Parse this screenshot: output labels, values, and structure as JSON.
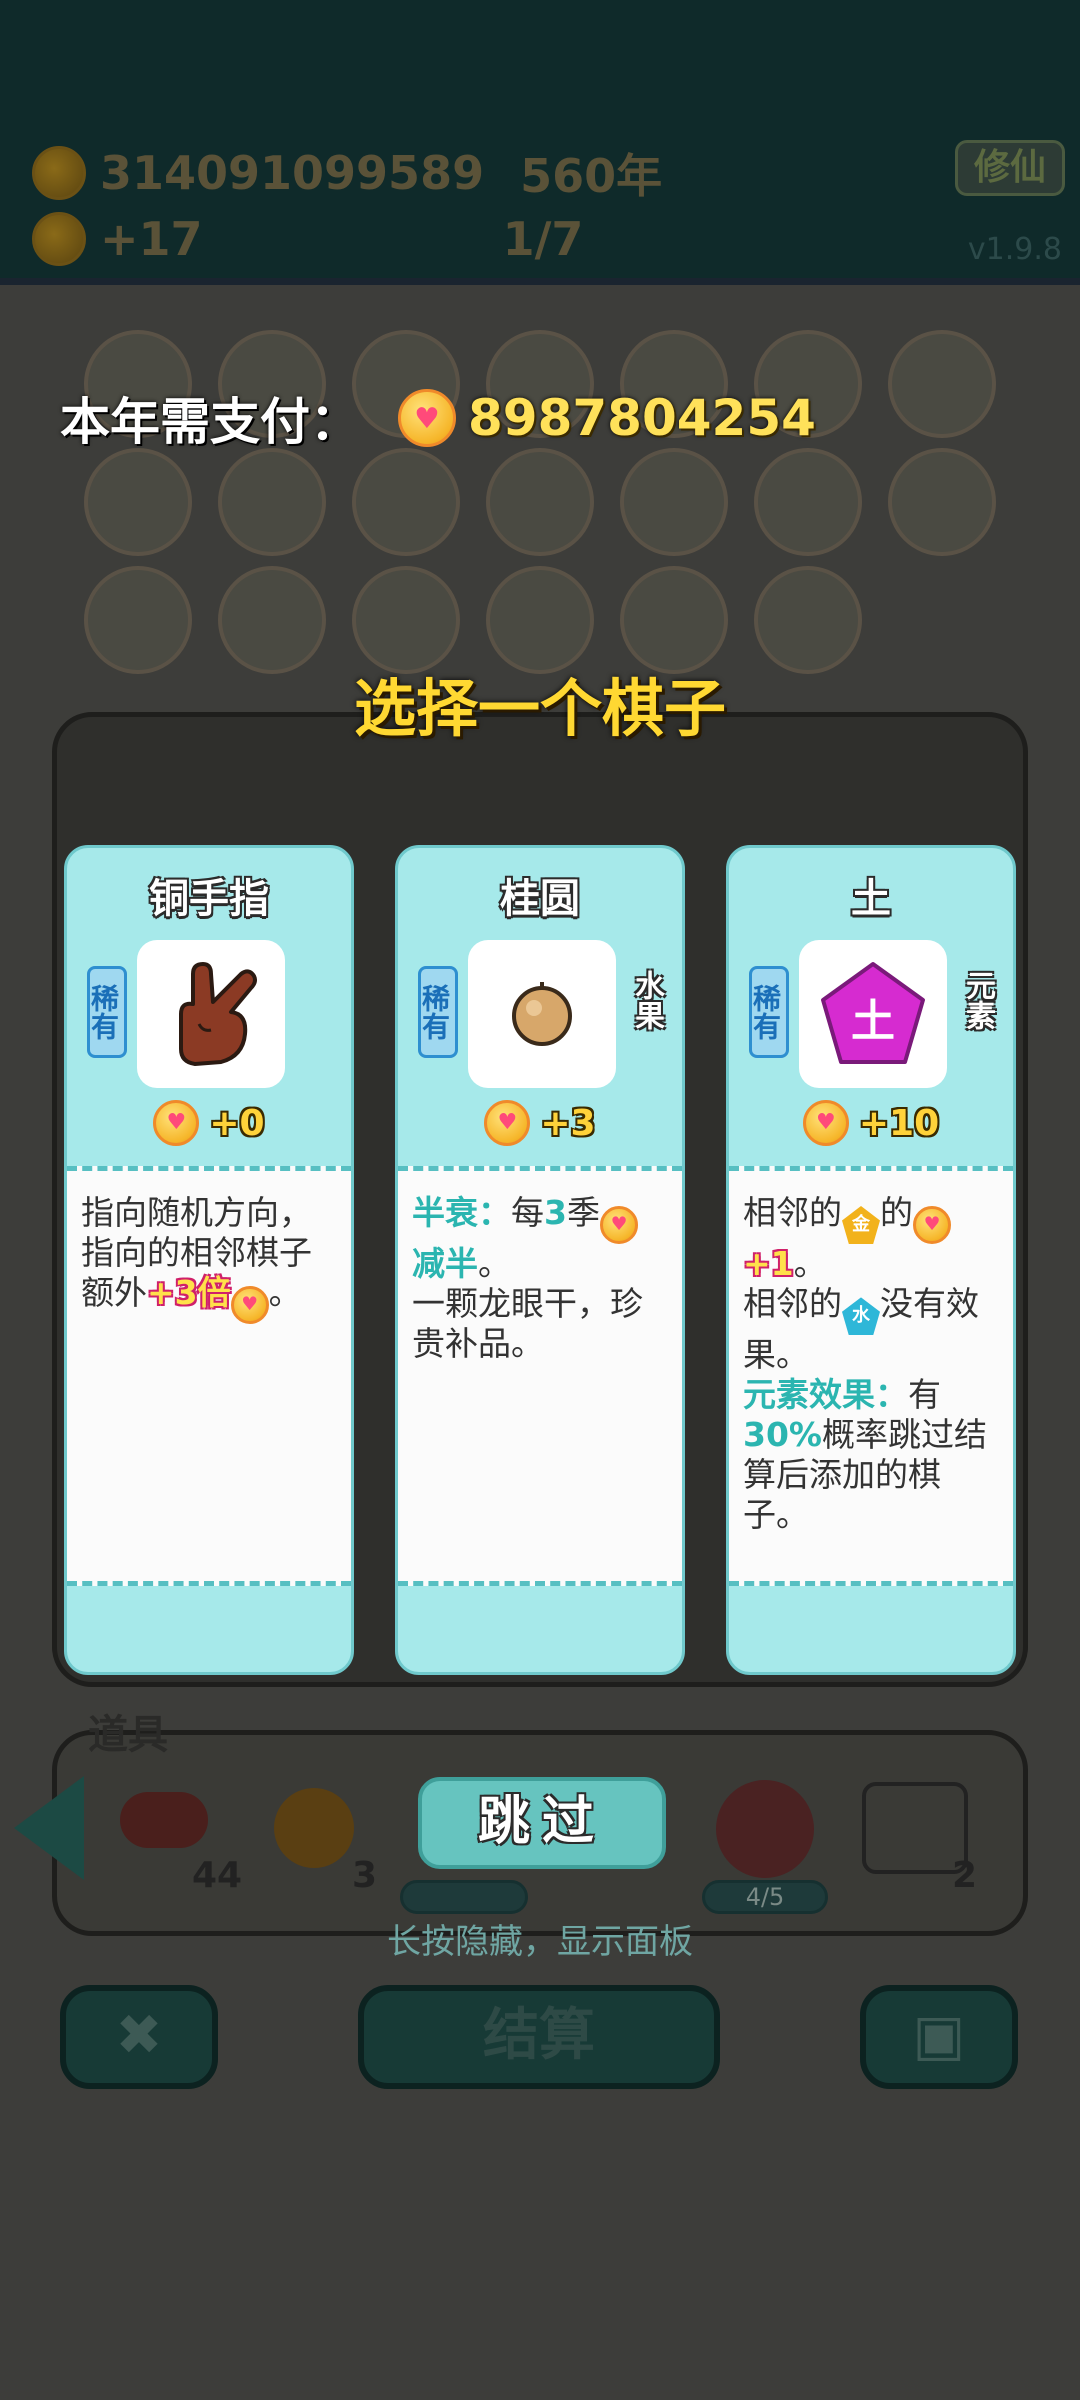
{
  "hud": {
    "coins": "314091099589",
    "year": "560年",
    "income": "+17",
    "progress": "1/7",
    "cultivate_label": "修仙",
    "version": "v1.9.8"
  },
  "payment": {
    "label": "本年需支付：",
    "amount": "8987804254"
  },
  "choose_title": "选择一个棋子",
  "cards": [
    {
      "name": "铜手指",
      "rarity": "稀有",
      "category": "",
      "value": "+0",
      "icon": "pointing-hand-icon",
      "desc": {
        "line1": "指向随机方向，",
        "line2": "指向的相邻棋子",
        "line3_prefix": "额外",
        "bonus": "+3倍",
        "suffix": "。"
      }
    },
    {
      "name": "桂圆",
      "rarity": "稀有",
      "category": "水果",
      "value": "+3",
      "icon": "longan-icon",
      "desc": {
        "key1": "半衰：",
        "pre": "每",
        "num": "3",
        "post": "季",
        "key2": "减半",
        "dot": "。",
        "flavor": "一颗龙眼干，珍贵补品。"
      }
    },
    {
      "name": "土",
      "rarity": "稀有",
      "category": "元素",
      "value": "+10",
      "icon": "earth-element-icon",
      "art_char": "土",
      "desc": {
        "adj1": "相邻的",
        "gold_char": "金",
        "of": "的",
        "plus": "+1",
        "dot1": "。",
        "adj2": "相邻的",
        "water_char": "水",
        "no_effect": "没有效果。",
        "elem_label": "元素效果：",
        "has": "有",
        "pct": "30%",
        "rest": "概率跳过结算后添加的棋子。"
      }
    }
  ],
  "tools": {
    "title": "道具",
    "counts": [
      "44",
      "3",
      "2"
    ],
    "charge": "4/5"
  },
  "skip_label": "跳过",
  "hint": "长按隐藏，显示面板",
  "settle_label": "结算"
}
